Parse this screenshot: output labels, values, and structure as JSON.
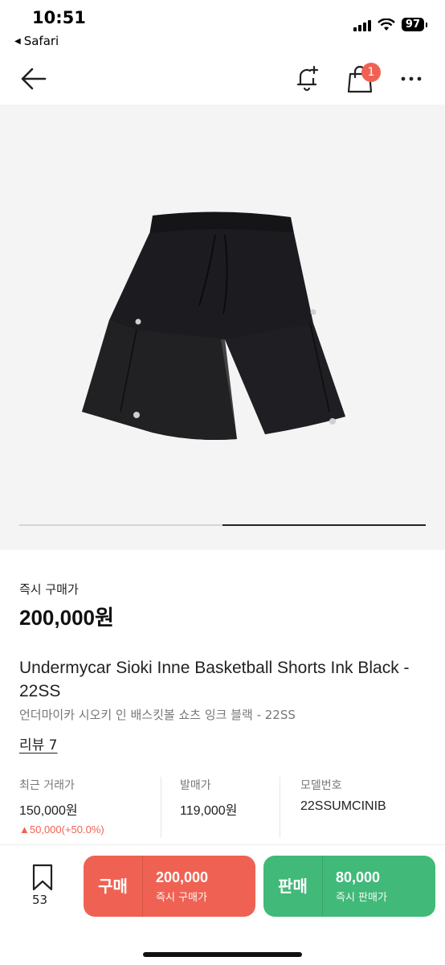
{
  "status_bar": {
    "time": "10:51",
    "back_app": "Safari",
    "battery": "97"
  },
  "nav": {
    "cart_badge": "1"
  },
  "product": {
    "image_alt": "Black basketball shorts",
    "carousel_progress": 0.5,
    "price_label": "즉시 구매가",
    "price": "200,000원",
    "title": "Undermycar Sioki Inne Basketball Shorts Ink Black - 22SS",
    "subtitle": "언더마이카 시오키 인 배스킷볼 쇼츠 잉크 블랙 - 22SS",
    "review": "리뷰 7"
  },
  "stats": {
    "recent": {
      "label": "최근 거래가",
      "value": "150,000원",
      "change": "▲50,000(+50.0%)"
    },
    "release": {
      "label": "발매가",
      "value": "119,000원"
    },
    "model": {
      "label": "모델번호",
      "value": "22SSUMCINIB"
    }
  },
  "bottom": {
    "bookmark_count": "53",
    "buy": {
      "label": "구매",
      "price": "200,000",
      "sub": "즉시 구매가"
    },
    "sell": {
      "label": "판매",
      "price": "80,000",
      "sub": "즉시 판매가"
    }
  },
  "colors": {
    "buy": "#ef6253",
    "sell": "#41b979",
    "badge": "#ef6253",
    "price_up": "#ef6253"
  }
}
